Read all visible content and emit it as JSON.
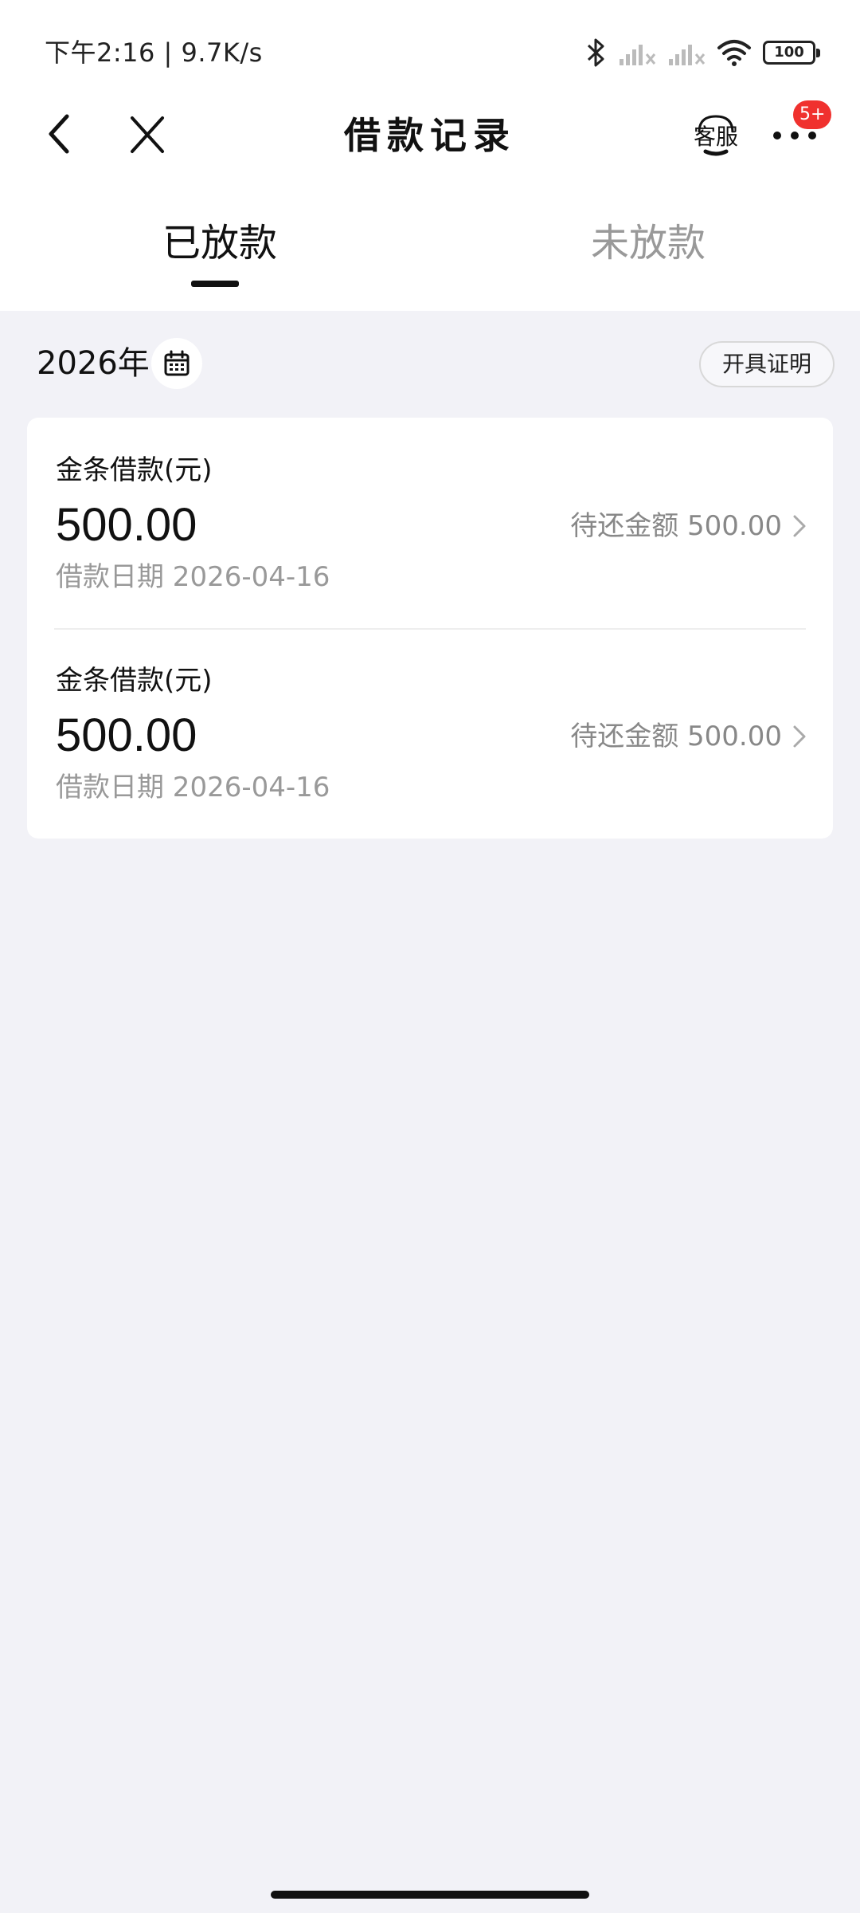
{
  "status_bar": {
    "time_speed": "下午2:16 | 9.7K/s",
    "battery": "100"
  },
  "nav": {
    "title": "借款记录",
    "service_label": "客服",
    "more_badge": "5+"
  },
  "tabs": [
    {
      "label": "已放款",
      "active": true
    },
    {
      "label": "未放款",
      "active": false
    }
  ],
  "filter": {
    "year": "2026年",
    "certificate_button": "开具证明"
  },
  "records": [
    {
      "title": "金条借款(元)",
      "amount": "500.00",
      "due": "待还金额 500.00",
      "date": "借款日期 2026-04-16"
    },
    {
      "title": "金条借款(元)",
      "amount": "500.00",
      "due": "待还金额 500.00",
      "date": "借款日期 2026-04-16"
    }
  ],
  "colors": {
    "badge": "#f0312e",
    "page_background": "#f2f2f7",
    "muted_text": "#999999"
  },
  "icons": [
    "back-arrow-icon",
    "close-icon",
    "customer-service-icon",
    "more-icon",
    "calendar-icon",
    "chevron-right-icon",
    "bluetooth-icon",
    "signal-icon",
    "wifi-icon",
    "battery-icon"
  ]
}
